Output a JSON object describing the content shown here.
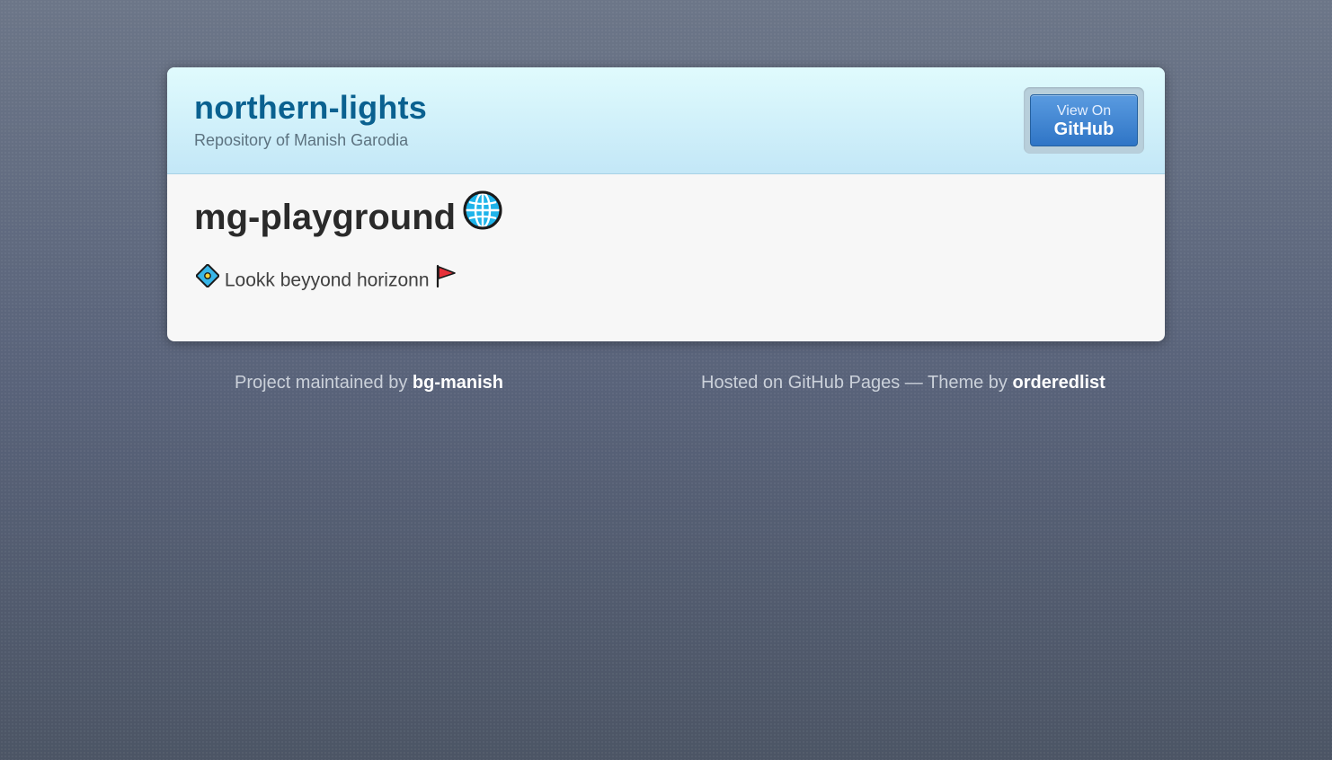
{
  "header": {
    "title": "northern-lights",
    "subtitle": "Repository of Manish Garodia",
    "github_button": {
      "small_label": "View On",
      "big_label": "GitHub"
    }
  },
  "main": {
    "heading": "mg-playground",
    "heading_icon": "globe-icon",
    "tagline": "Lookk beyyond horizonn",
    "tagline_leading_icon": "diamond-icon",
    "tagline_trailing_icon": "flag-icon"
  },
  "footer": {
    "left_prefix": "Project maintained by",
    "left_link": "bg-manish",
    "right_prefix": "Hosted on GitHub Pages — Theme by",
    "right_link": "orderedlist"
  },
  "colors": {
    "title": "#0a6190",
    "github_button": "#3a82d0",
    "background": "#5d6778"
  }
}
